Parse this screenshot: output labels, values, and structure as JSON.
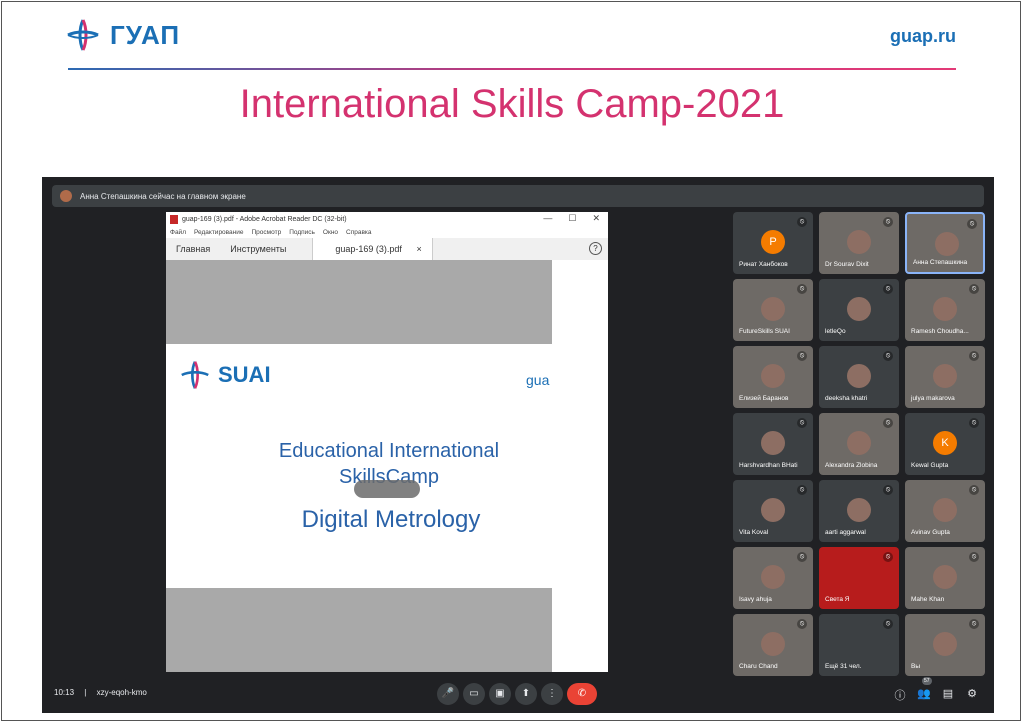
{
  "header": {
    "logo_text": "ГУАП",
    "site": "guap.ru",
    "title": "International Skills Camp-2021"
  },
  "meet": {
    "banner": "Анна Степашкина сейчас на главном экране",
    "time": "10:13",
    "code": "xzy-eqoh-kmo",
    "participants_badge": "57",
    "controls": {
      "mic": "🎤",
      "camera": "▭",
      "captions": "▣",
      "present": "⬆",
      "more": "⋮",
      "end": "✆"
    },
    "right_icons": {
      "info": "ⓘ",
      "people": "👥",
      "chat": "▤",
      "activities": "⚙"
    }
  },
  "acrobat": {
    "window_title": "guap-169 (3).pdf - Adobe Acrobat Reader DC (32-bit)",
    "win_min": "—",
    "win_max": "☐",
    "win_close": "✕",
    "menu": [
      "Файл",
      "Редактирование",
      "Просмотр",
      "Подпись",
      "Окно",
      "Справка"
    ],
    "tab_home": "Главная",
    "tab_tools": "Инструменты",
    "doc_tab": "guap-169 (3).pdf",
    "doc_close": "×",
    "help": "?"
  },
  "slide": {
    "logo_text": "SUAI",
    "gua": "gua",
    "line1": "Educational International",
    "line2": "SkillsCamp",
    "line3": "Digital Metrology"
  },
  "tiles": [
    {
      "name": "Ринат Ханбоков",
      "initial": "P",
      "color": "#f57c00"
    },
    {
      "name": "Dr Sourav Dixit"
    },
    {
      "name": "Анна Степашкина"
    },
    {
      "name": "FutureSkills SUAI"
    },
    {
      "name": "letleQo"
    },
    {
      "name": "Ramesh Choudha..."
    },
    {
      "name": "Елизей Баранов"
    },
    {
      "name": "deeksha khatri"
    },
    {
      "name": "julya makarova"
    },
    {
      "name": "Harshvardhan BHati"
    },
    {
      "name": "Alexandra Zlobina"
    },
    {
      "name": "Kewal Gupta",
      "initial": "K",
      "color": "#f57c00"
    },
    {
      "name": "Vita Koval"
    },
    {
      "name": "aarti aggarwal"
    },
    {
      "name": "Avinav Gupta"
    },
    {
      "name": "Isavy ahuja"
    },
    {
      "name": "Света Я"
    },
    {
      "name": "Mahe Khan"
    },
    {
      "name": "Charu Chand"
    },
    {
      "name": "Ещё 31 чел."
    },
    {
      "name": "Вы"
    }
  ]
}
